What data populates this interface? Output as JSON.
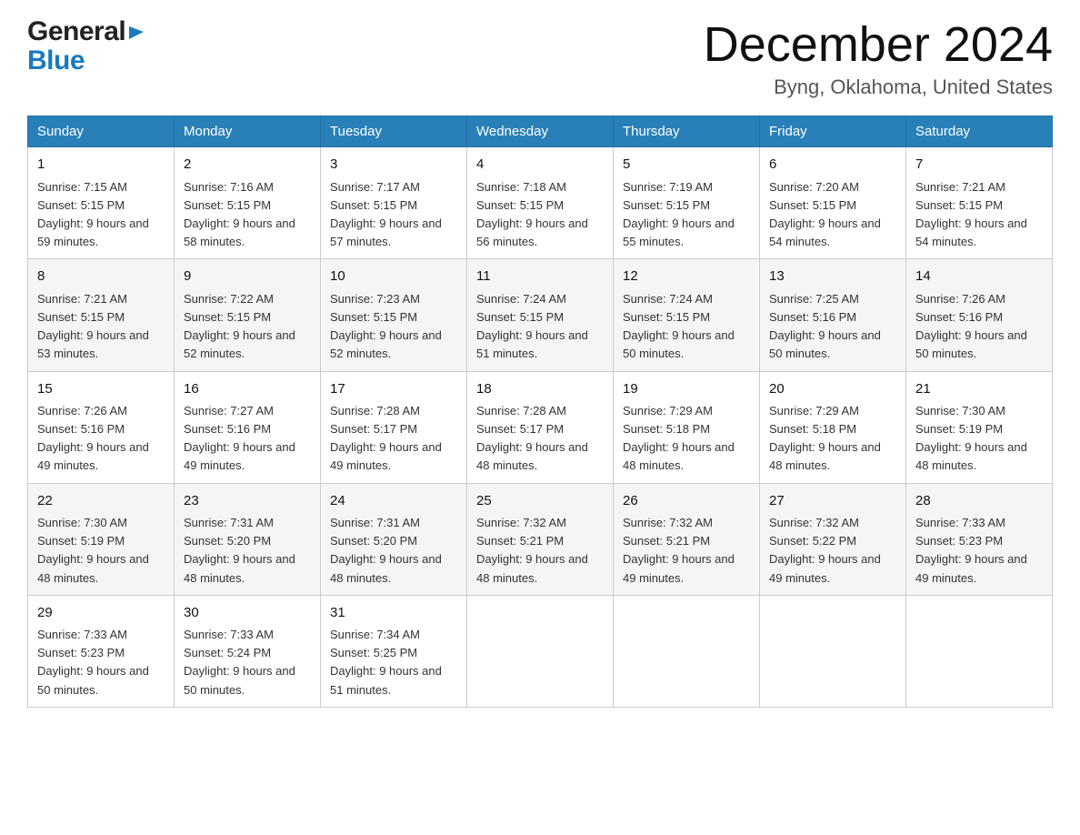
{
  "header": {
    "logo_general": "General",
    "logo_blue": "Blue",
    "month_title": "December 2024",
    "location": "Byng, Oklahoma, United States"
  },
  "days_of_week": [
    "Sunday",
    "Monday",
    "Tuesday",
    "Wednesday",
    "Thursday",
    "Friday",
    "Saturday"
  ],
  "weeks": [
    [
      {
        "day": "1",
        "sunrise": "7:15 AM",
        "sunset": "5:15 PM",
        "daylight": "9 hours and 59 minutes."
      },
      {
        "day": "2",
        "sunrise": "7:16 AM",
        "sunset": "5:15 PM",
        "daylight": "9 hours and 58 minutes."
      },
      {
        "day": "3",
        "sunrise": "7:17 AM",
        "sunset": "5:15 PM",
        "daylight": "9 hours and 57 minutes."
      },
      {
        "day": "4",
        "sunrise": "7:18 AM",
        "sunset": "5:15 PM",
        "daylight": "9 hours and 56 minutes."
      },
      {
        "day": "5",
        "sunrise": "7:19 AM",
        "sunset": "5:15 PM",
        "daylight": "9 hours and 55 minutes."
      },
      {
        "day": "6",
        "sunrise": "7:20 AM",
        "sunset": "5:15 PM",
        "daylight": "9 hours and 54 minutes."
      },
      {
        "day": "7",
        "sunrise": "7:21 AM",
        "sunset": "5:15 PM",
        "daylight": "9 hours and 54 minutes."
      }
    ],
    [
      {
        "day": "8",
        "sunrise": "7:21 AM",
        "sunset": "5:15 PM",
        "daylight": "9 hours and 53 minutes."
      },
      {
        "day": "9",
        "sunrise": "7:22 AM",
        "sunset": "5:15 PM",
        "daylight": "9 hours and 52 minutes."
      },
      {
        "day": "10",
        "sunrise": "7:23 AM",
        "sunset": "5:15 PM",
        "daylight": "9 hours and 52 minutes."
      },
      {
        "day": "11",
        "sunrise": "7:24 AM",
        "sunset": "5:15 PM",
        "daylight": "9 hours and 51 minutes."
      },
      {
        "day": "12",
        "sunrise": "7:24 AM",
        "sunset": "5:15 PM",
        "daylight": "9 hours and 50 minutes."
      },
      {
        "day": "13",
        "sunrise": "7:25 AM",
        "sunset": "5:16 PM",
        "daylight": "9 hours and 50 minutes."
      },
      {
        "day": "14",
        "sunrise": "7:26 AM",
        "sunset": "5:16 PM",
        "daylight": "9 hours and 50 minutes."
      }
    ],
    [
      {
        "day": "15",
        "sunrise": "7:26 AM",
        "sunset": "5:16 PM",
        "daylight": "9 hours and 49 minutes."
      },
      {
        "day": "16",
        "sunrise": "7:27 AM",
        "sunset": "5:16 PM",
        "daylight": "9 hours and 49 minutes."
      },
      {
        "day": "17",
        "sunrise": "7:28 AM",
        "sunset": "5:17 PM",
        "daylight": "9 hours and 49 minutes."
      },
      {
        "day": "18",
        "sunrise": "7:28 AM",
        "sunset": "5:17 PM",
        "daylight": "9 hours and 48 minutes."
      },
      {
        "day": "19",
        "sunrise": "7:29 AM",
        "sunset": "5:18 PM",
        "daylight": "9 hours and 48 minutes."
      },
      {
        "day": "20",
        "sunrise": "7:29 AM",
        "sunset": "5:18 PM",
        "daylight": "9 hours and 48 minutes."
      },
      {
        "day": "21",
        "sunrise": "7:30 AM",
        "sunset": "5:19 PM",
        "daylight": "9 hours and 48 minutes."
      }
    ],
    [
      {
        "day": "22",
        "sunrise": "7:30 AM",
        "sunset": "5:19 PM",
        "daylight": "9 hours and 48 minutes."
      },
      {
        "day": "23",
        "sunrise": "7:31 AM",
        "sunset": "5:20 PM",
        "daylight": "9 hours and 48 minutes."
      },
      {
        "day": "24",
        "sunrise": "7:31 AM",
        "sunset": "5:20 PM",
        "daylight": "9 hours and 48 minutes."
      },
      {
        "day": "25",
        "sunrise": "7:32 AM",
        "sunset": "5:21 PM",
        "daylight": "9 hours and 48 minutes."
      },
      {
        "day": "26",
        "sunrise": "7:32 AM",
        "sunset": "5:21 PM",
        "daylight": "9 hours and 49 minutes."
      },
      {
        "day": "27",
        "sunrise": "7:32 AM",
        "sunset": "5:22 PM",
        "daylight": "9 hours and 49 minutes."
      },
      {
        "day": "28",
        "sunrise": "7:33 AM",
        "sunset": "5:23 PM",
        "daylight": "9 hours and 49 minutes."
      }
    ],
    [
      {
        "day": "29",
        "sunrise": "7:33 AM",
        "sunset": "5:23 PM",
        "daylight": "9 hours and 50 minutes."
      },
      {
        "day": "30",
        "sunrise": "7:33 AM",
        "sunset": "5:24 PM",
        "daylight": "9 hours and 50 minutes."
      },
      {
        "day": "31",
        "sunrise": "7:34 AM",
        "sunset": "5:25 PM",
        "daylight": "9 hours and 51 minutes."
      },
      null,
      null,
      null,
      null
    ]
  ],
  "labels": {
    "sunrise_prefix": "Sunrise: ",
    "sunset_prefix": "Sunset: ",
    "daylight_prefix": "Daylight: "
  }
}
